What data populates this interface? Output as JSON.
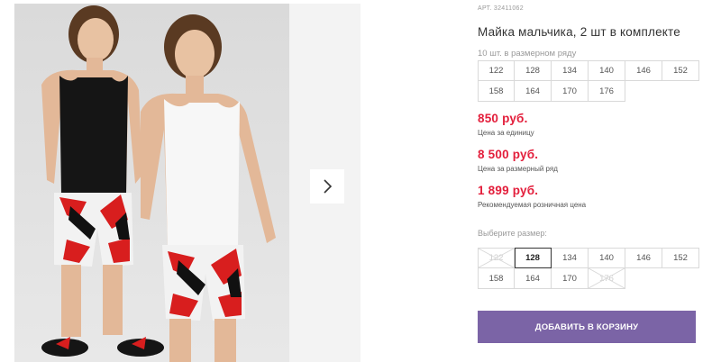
{
  "product": {
    "article": "АРТ. 32411062",
    "title": "Майка мальчика, 2 шт в комплекте",
    "pack_note": "10 шт. в размерном ряду"
  },
  "pack_sizes": [
    "122",
    "128",
    "134",
    "140",
    "146",
    "152",
    "158",
    "164",
    "170",
    "176"
  ],
  "prices": {
    "unit_price": "850 руб.",
    "unit_label": "Цена за единицу",
    "pack_price": "8 500 руб.",
    "pack_label": "Цена за размерный ряд",
    "retail_price": "1 899 руб.",
    "retail_label": "Рекомендуемая розничная цена"
  },
  "size_select": {
    "label": "Выберите размер:",
    "options": [
      {
        "size": "122",
        "state": "disabled"
      },
      {
        "size": "128",
        "state": "selected"
      },
      {
        "size": "134",
        "state": "available"
      },
      {
        "size": "140",
        "state": "available"
      },
      {
        "size": "146",
        "state": "available"
      },
      {
        "size": "152",
        "state": "available"
      },
      {
        "size": "158",
        "state": "available"
      },
      {
        "size": "164",
        "state": "available"
      },
      {
        "size": "170",
        "state": "available"
      },
      {
        "size": "176",
        "state": "disabled"
      }
    ]
  },
  "add_to_cart": "ДОБАВИТЬ В КОРЗИНУ",
  "colors": {
    "accent": "#7b64a6",
    "price": "#e31e3b"
  },
  "icons": {
    "next": "chevron-right-icon"
  }
}
